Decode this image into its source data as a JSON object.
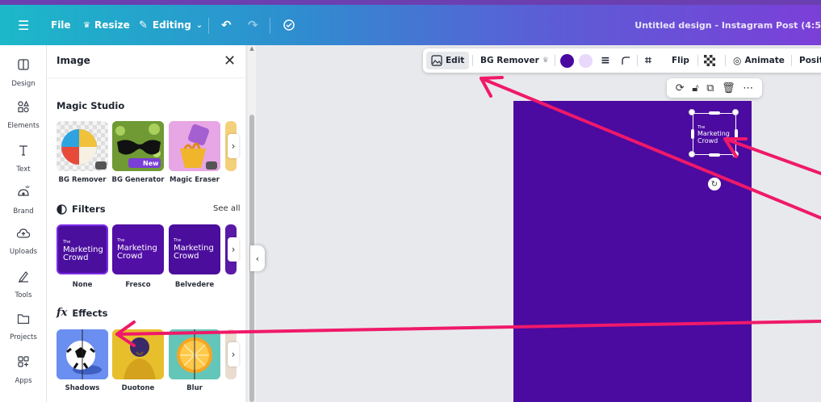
{
  "topbar": {
    "file": "File",
    "resize": "Resize",
    "editing": "Editing",
    "title": "Untitled design - Instagram Post (4:5"
  },
  "rail": [
    {
      "label": "Design",
      "icon": "design-icon"
    },
    {
      "label": "Elements",
      "icon": "elements-icon"
    },
    {
      "label": "Text",
      "icon": "text-icon"
    },
    {
      "label": "Brand",
      "icon": "brand-icon"
    },
    {
      "label": "Uploads",
      "icon": "uploads-icon"
    },
    {
      "label": "Tools",
      "icon": "tools-icon"
    },
    {
      "label": "Projects",
      "icon": "projects-icon"
    },
    {
      "label": "Apps",
      "icon": "apps-icon"
    }
  ],
  "panel": {
    "title": "Image",
    "magic_studio": {
      "title": "Magic Studio",
      "items": [
        {
          "label": "BG Remover"
        },
        {
          "label": "BG Generator",
          "badge": "New"
        },
        {
          "label": "Magic Eraser"
        }
      ]
    },
    "filters": {
      "title": "Filters",
      "see_all": "See all",
      "items": [
        {
          "label": "None"
        },
        {
          "label": "Fresco"
        },
        {
          "label": "Belvedere"
        }
      ],
      "thumb_small": "The",
      "thumb_big": "Marketing Crowd"
    },
    "effects": {
      "title": "Effects",
      "items": [
        {
          "label": "Shadows"
        },
        {
          "label": "Duotone"
        },
        {
          "label": "Blur"
        }
      ]
    }
  },
  "context_toolbar": {
    "edit": "Edit",
    "bg_remover": "BG Remover",
    "flip": "Flip",
    "animate": "Animate",
    "position": "Positi",
    "colors": [
      "#4a0aa0",
      "#e8d8fb"
    ]
  },
  "canvas": {
    "color": "#4b0aa0",
    "logo_small": "The",
    "logo_big": "Marketing Crowd"
  },
  "annotations": {
    "arrow_color": "#f0196a"
  }
}
